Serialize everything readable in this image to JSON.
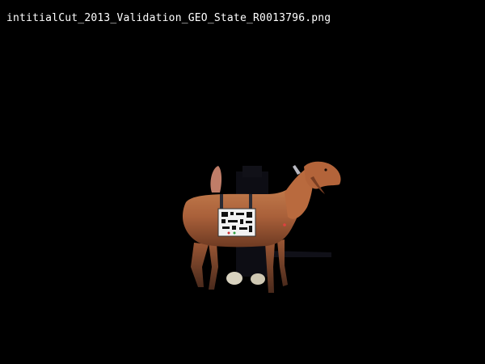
{
  "viewer": {
    "filename": "intitialCut_2013_Validation_GEO_State_R0013796.png",
    "background_color": "#000000",
    "text_color": "#ffffff"
  },
  "image": {
    "subject_icon": "goat-photo",
    "subject_color": "#b96a3e",
    "tag_color": "#f2f2f2"
  }
}
